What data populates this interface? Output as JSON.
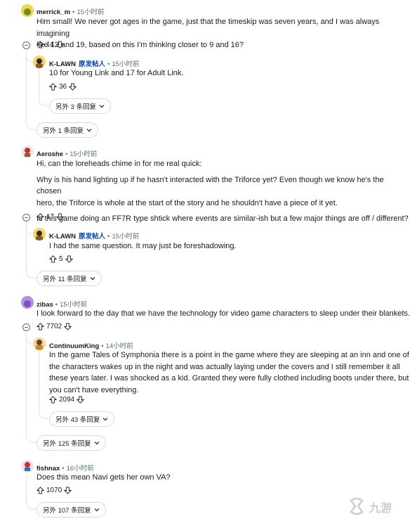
{
  "comments": [
    {
      "user": "merrick_m",
      "time": "15小时前",
      "lines": [
        "Him small! We never got ages in the game, just that the timeskip was seven years, and I was always imagining",
        "like 12 and 19, based on this I'm thinking closer to 9 and 16?"
      ],
      "votes": "14",
      "reply": {
        "user": "K-LAWN",
        "badge": "原发帖人",
        "time": "15小时前",
        "lines": [
          "10 for Young Link and 17 for Adult Link."
        ],
        "votes": "36",
        "more": "另外 3 条回复"
      },
      "more": "另外 1 条回复"
    },
    {
      "user": "Aeroshe",
      "time": "15小时前",
      "lines": [
        "Hi, can the loreheads chime in for me real quick:",
        "Why is his hand lighting up if he hasn't interacted with the Triforce yet? Even though we know he's the chosen",
        "hero, the Triforce is whole at the start of the story and he shouldn't have a piece of it yet.",
        "Is this game doing an FF7R type shtick where events are similar-ish but a few major things are off / different?"
      ],
      "votes": "17",
      "reply": {
        "user": "K-LAWN",
        "badge": "原发帖人",
        "time": "15小时前",
        "lines": [
          "I had the same question. It may just be foreshadowing."
        ],
        "votes": "5"
      },
      "more": "另外 11 条回复"
    },
    {
      "user": "zibas",
      "time": "15小时前",
      "lines": [
        "I look forward to the day that we have the technology for video game characters to sleep under their blankets."
      ],
      "votes": "7702",
      "reply": {
        "user": "ContinuumKing",
        "time": "14小时前",
        "lines": [
          "In the game Tales of Symphonia there is a point in the game where they are sleeping at an inn and one of",
          "the characters wakes up in the night and was actually laying under the covers and I still remember it all",
          "these years later. I was shocked as a kid. Granted they were fully clothed including boots under there, but",
          "you can't have everything."
        ],
        "votes": "2094",
        "more": "另外 43 条回复"
      },
      "more": "另外 125 条回复"
    },
    {
      "user": "fishnax",
      "time": "16小时前",
      "lines": [
        "Does this mean Navi gets her own VA?"
      ],
      "votes": "1070",
      "more": "另外 107 条回复"
    }
  ],
  "watermark": "九游",
  "colors": {
    "op_badge": "#0045ac",
    "meta": "#576f76",
    "thread_line": "#e0e3e5"
  },
  "icons": [
    "upvote-icon",
    "downvote-icon",
    "chevron-down-icon",
    "collapse-icon",
    "avatar"
  ]
}
